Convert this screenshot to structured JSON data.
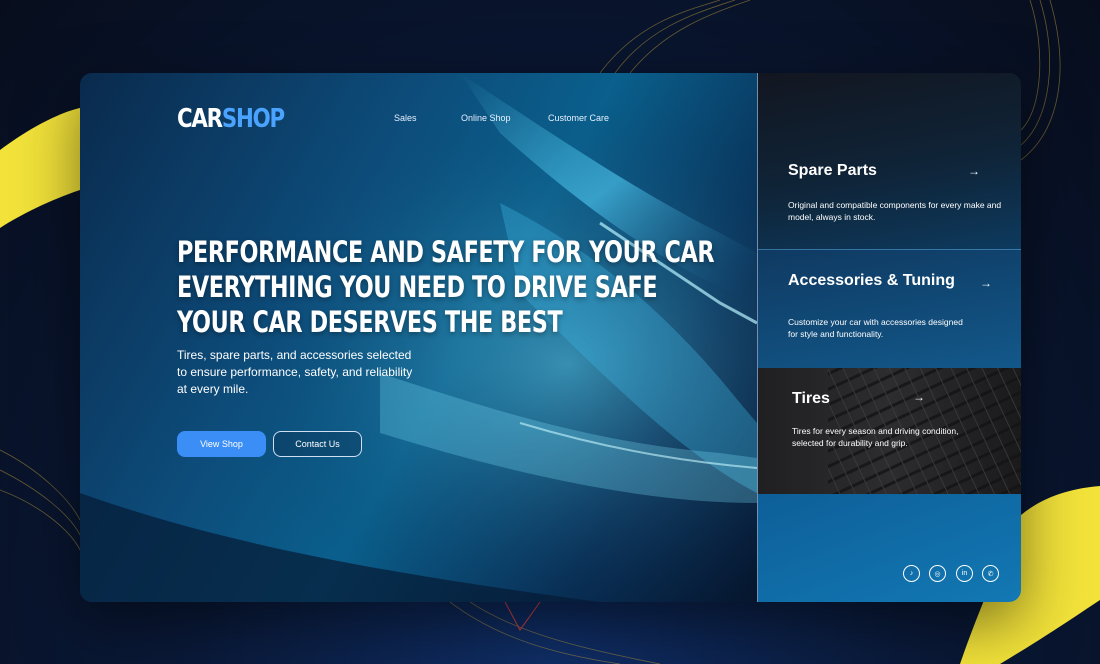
{
  "brand": {
    "part1": "CAR",
    "part2": "SHOP"
  },
  "nav": {
    "items": [
      "Sales",
      "Online Shop",
      "Customer Care"
    ]
  },
  "hero": {
    "headline": [
      "PERFORMANCE AND SAFETY FOR YOUR CAR",
      "EVERYTHING YOU NEED TO DRIVE SAFE",
      "YOUR CAR DESERVES THE BEST"
    ],
    "subtitle": "Tires, spare parts, and accessories selected to ensure performance, safety, and reliability at every mile.",
    "primary_button": "View Shop",
    "secondary_button": "Contact Us"
  },
  "categories": [
    {
      "title": "Spare Parts",
      "description": "Original and compatible components for every make and model, always in stock.",
      "arrow": "→"
    },
    {
      "title": "Accessories & Tuning",
      "description": "Customize your car with accessories designed for style and functionality.",
      "arrow": "→"
    },
    {
      "title": "Tires",
      "description": "Tires for every season and driving condition, selected for durability and grip.",
      "arrow": "→"
    }
  ],
  "social": [
    {
      "icon": "tiktok-icon",
      "glyph": "♪"
    },
    {
      "icon": "instagram-icon",
      "glyph": "◎"
    },
    {
      "icon": "linkedin-icon",
      "glyph": "in"
    },
    {
      "icon": "phone-icon",
      "glyph": "✆"
    }
  ],
  "colors": {
    "accent": "#3b8ef5",
    "brand_blue": "#4aa3ff",
    "yellow": "#f7e43a"
  }
}
